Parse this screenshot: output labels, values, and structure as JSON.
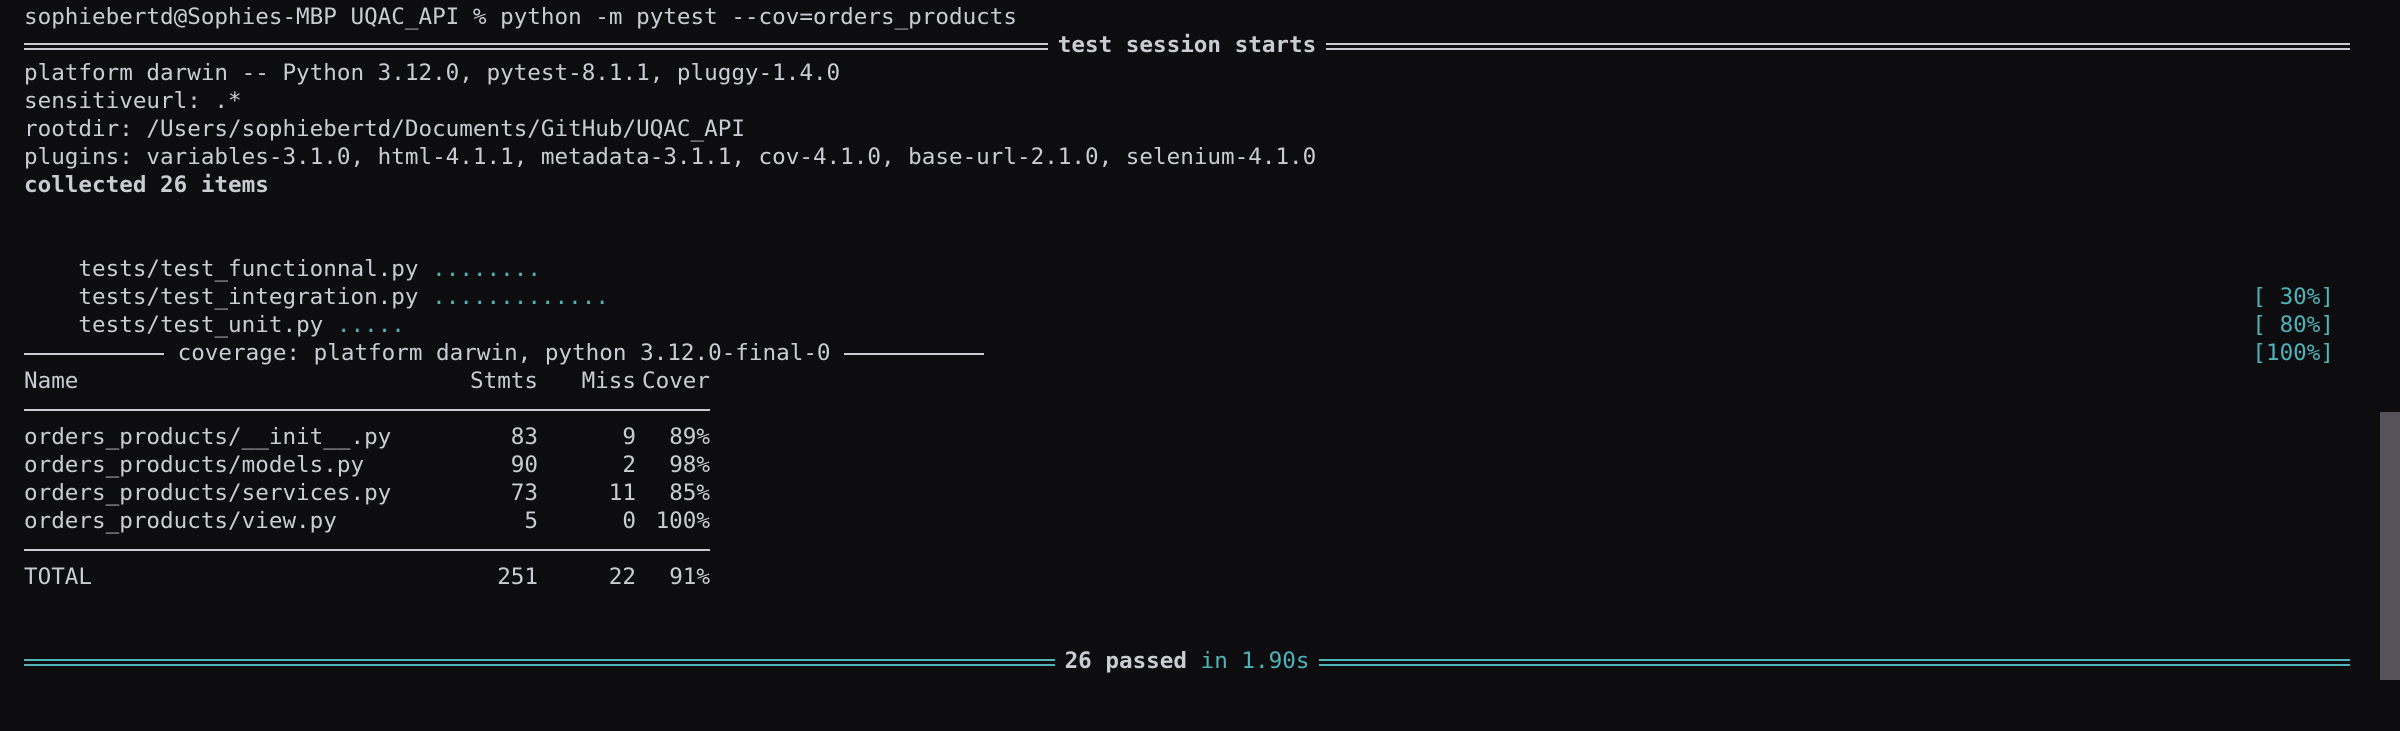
{
  "prompt": "sophiebertd@Sophies-MBP UQAC_API % python -m pytest --cov=orders_products",
  "session_header": "test session starts",
  "platform_line": "platform darwin -- Python 3.12.0, pytest-8.1.1, pluggy-1.4.0",
  "sensitiveurl_line": "sensitiveurl: .*",
  "rootdir_line": "rootdir: /Users/sophiebertd/Documents/GitHub/UQAC_API",
  "plugins_line": "plugins: variables-3.1.0, html-4.1.1, metadata-3.1.1, cov-4.1.0, base-url-2.1.0, selenium-4.1.0",
  "collected_line": "collected 26 items",
  "test_files": [
    {
      "path": "tests/test_functionnal.py",
      "dots": "........",
      "percent": "[ 30%]"
    },
    {
      "path": "tests/test_integration.py",
      "dots": ".............",
      "percent": "[ 80%]"
    },
    {
      "path": "tests/test_unit.py",
      "dots": ".....",
      "percent": "[100%]"
    }
  ],
  "coverage_header": " coverage: platform darwin, python 3.12.0-final-0 ",
  "coverage_table": {
    "headers": [
      "Name",
      "Stmts",
      "Miss",
      "Cover"
    ],
    "rows": [
      {
        "name": "orders_products/__init__.py",
        "stmts": "83",
        "miss": "9",
        "cover": "89%"
      },
      {
        "name": "orders_products/models.py",
        "stmts": "90",
        "miss": "2",
        "cover": "98%"
      },
      {
        "name": "orders_products/services.py",
        "stmts": "73",
        "miss": "11",
        "cover": "85%"
      },
      {
        "name": "orders_products/view.py",
        "stmts": "5",
        "miss": "0",
        "cover": "100%"
      }
    ],
    "total": {
      "name": "TOTAL",
      "stmts": "251",
      "miss": "22",
      "cover": "91%"
    }
  },
  "summary": {
    "passed": "26 passed",
    "duration": "in 1.90s"
  },
  "colors": {
    "background": "#0d0d10",
    "text": "#c9ccd1",
    "accent_cyan": "#4fb3b8",
    "scrollbar": "#55525b"
  }
}
